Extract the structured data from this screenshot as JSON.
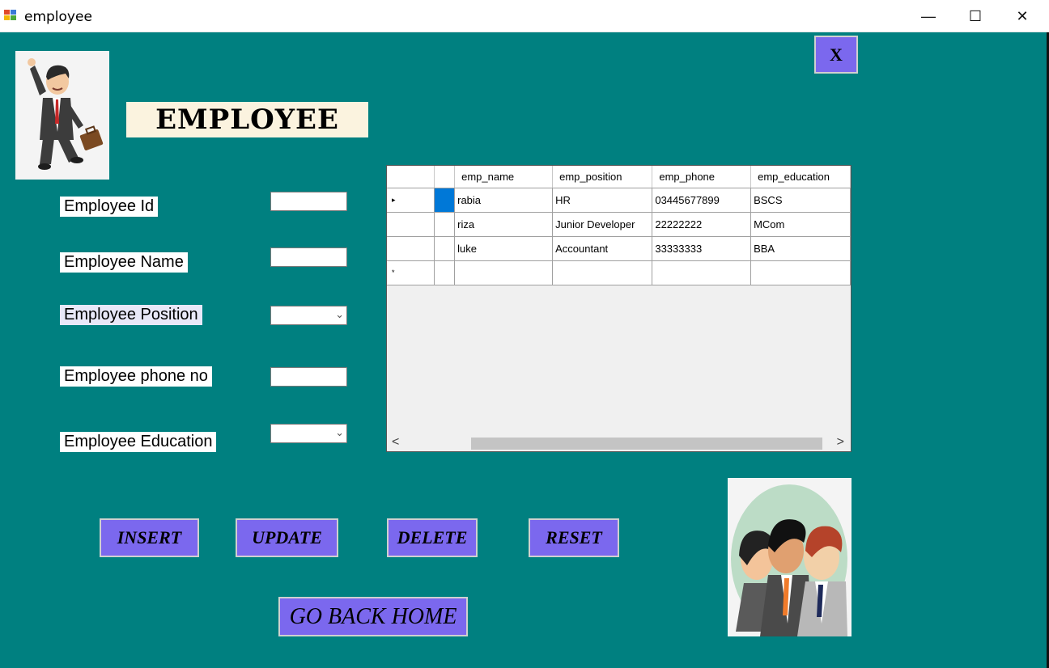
{
  "window": {
    "title": "employee",
    "minimize_glyph": "—",
    "maximize_glyph": "☐",
    "close_glyph": "✕",
    "icon": "winforms-app-icon"
  },
  "form": {
    "close_button": "X",
    "heading": "EMPLOYEE",
    "labels": {
      "id": "Employee Id",
      "name": "Employee Name",
      "position": "Employee Position",
      "phone": "Employee phone no",
      "education": "Employee Education"
    },
    "fields": {
      "id": "",
      "name": "",
      "position": "",
      "phone": "",
      "education": ""
    }
  },
  "grid": {
    "columns": [
      "emp_name",
      "emp_position",
      "emp_phone",
      "emp_education"
    ],
    "rows": [
      [
        "rabia",
        "HR",
        "03445677899",
        "BSCS"
      ],
      [
        "riza",
        "Junior Developer",
        "22222222",
        "MCom"
      ],
      [
        "luke",
        "Accountant",
        "33333333",
        "BBA"
      ]
    ],
    "current_row_marker": "▸",
    "new_row_marker": "*",
    "scroll_left": "<",
    "scroll_right": ">"
  },
  "buttons": {
    "insert": "INSERT",
    "update": "UPDATE",
    "delete": "DELETE",
    "reset": "RESET",
    "home": "GO BACK HOME"
  },
  "colors": {
    "background": "#008080",
    "button": "#7b68ee",
    "selection": "#0078d7"
  }
}
